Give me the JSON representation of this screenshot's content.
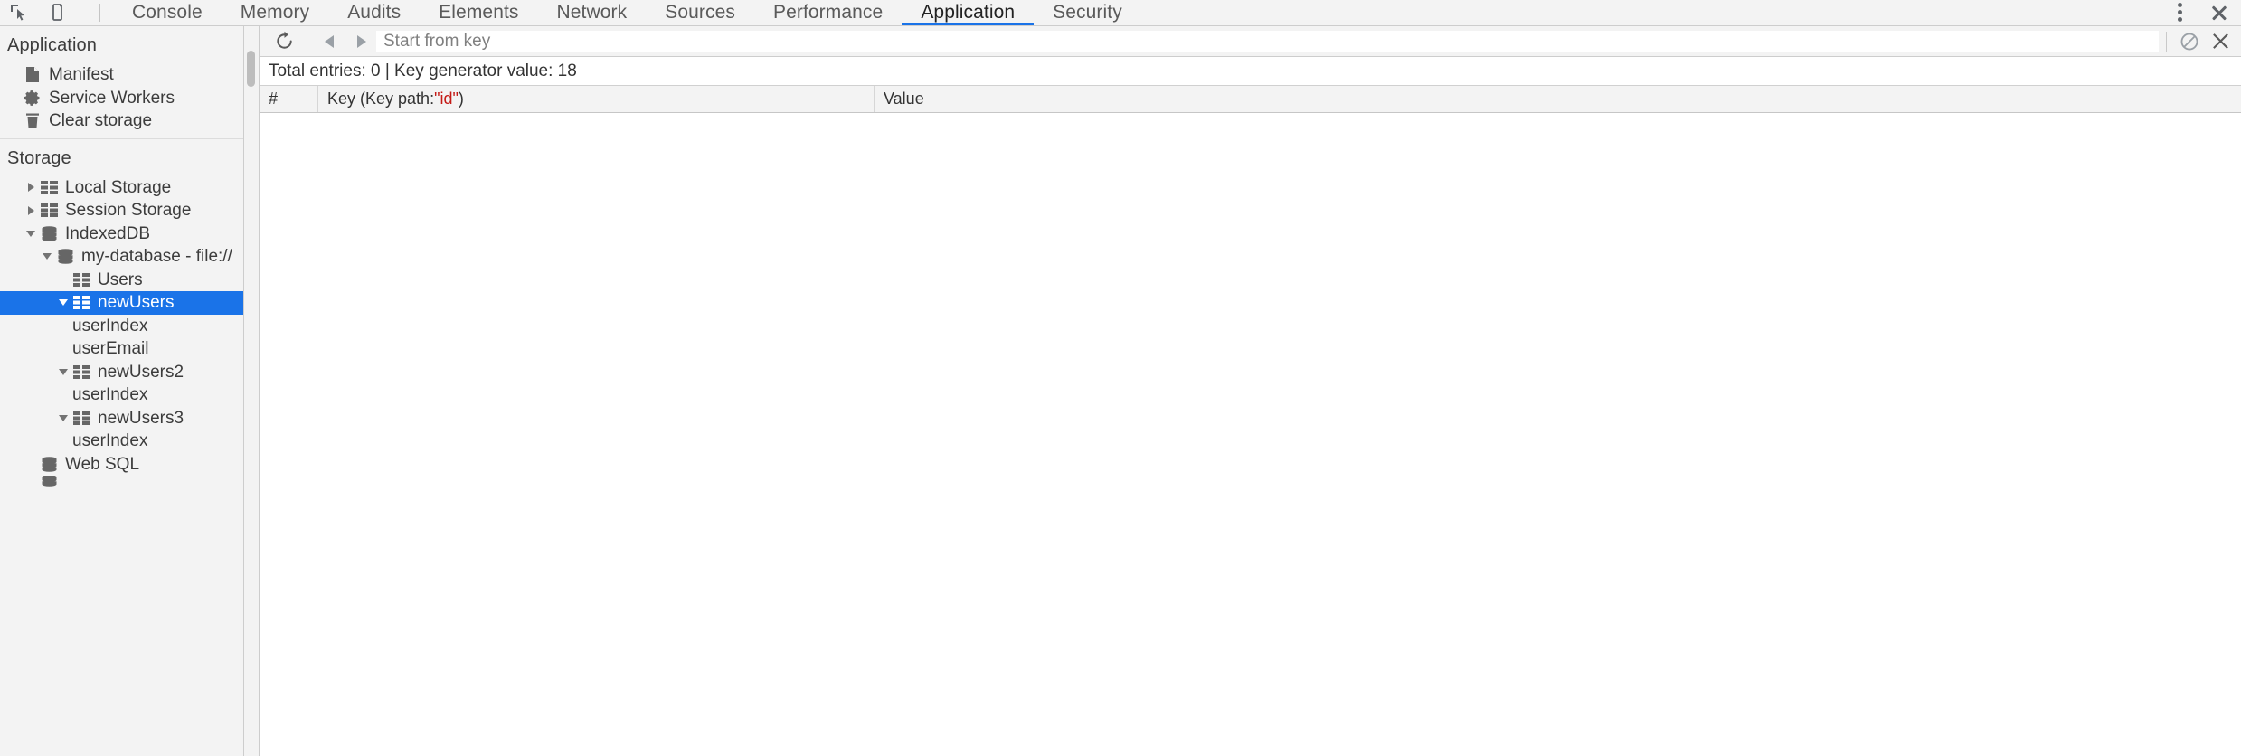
{
  "tabbar": {
    "left_icons": [
      {
        "name": "inspect-element-icon",
        "glyph": "inspect"
      },
      {
        "name": "device-toolbar-icon",
        "glyph": "device"
      }
    ],
    "tabs": [
      {
        "label": "Console",
        "active": false
      },
      {
        "label": "Memory",
        "active": false
      },
      {
        "label": "Audits",
        "active": false
      },
      {
        "label": "Elements",
        "active": false
      },
      {
        "label": "Network",
        "active": false
      },
      {
        "label": "Sources",
        "active": false
      },
      {
        "label": "Performance",
        "active": false
      },
      {
        "label": "Application",
        "active": true
      },
      {
        "label": "Security",
        "active": false
      }
    ],
    "active_tab": "Application",
    "more_options_label": "More options",
    "close_label": "Close DevTools",
    "accent_color": "#1a73e8"
  },
  "sidebar": {
    "application_section": {
      "title": "Application",
      "items": [
        {
          "label": "Manifest",
          "icon": "manifest-document-icon"
        },
        {
          "label": "Service Workers",
          "icon": "gear-icon"
        },
        {
          "label": "Clear storage",
          "icon": "trash-icon"
        }
      ]
    },
    "storage_section": {
      "title": "Storage",
      "items": [
        {
          "label": "Local Storage",
          "icon": "table-icon",
          "expanded": false,
          "indent": 1,
          "has_twisty": true,
          "selected": false
        },
        {
          "label": "Session Storage",
          "icon": "table-icon",
          "expanded": false,
          "indent": 1,
          "has_twisty": true,
          "selected": false
        },
        {
          "label": "IndexedDB",
          "icon": "database-icon",
          "expanded": true,
          "indent": 1,
          "has_twisty": true,
          "selected": false
        },
        {
          "label": "my-database - file://",
          "icon": "database-icon",
          "expanded": true,
          "indent": 2,
          "has_twisty": true,
          "selected": false
        },
        {
          "label": "Users",
          "icon": "table-icon",
          "expanded": false,
          "indent": 3,
          "has_twisty": false,
          "selected": false
        },
        {
          "label": "newUsers",
          "icon": "table-icon",
          "expanded": true,
          "indent": 3,
          "has_twisty": true,
          "selected": true
        },
        {
          "label": "userIndex",
          "icon": "none",
          "expanded": false,
          "indent": 4,
          "has_twisty": false,
          "selected": false
        },
        {
          "label": "userEmail",
          "icon": "none",
          "expanded": false,
          "indent": 4,
          "has_twisty": false,
          "selected": false
        },
        {
          "label": "newUsers2",
          "icon": "table-icon",
          "expanded": true,
          "indent": 3,
          "has_twisty": true,
          "selected": false
        },
        {
          "label": "userIndex",
          "icon": "none",
          "expanded": false,
          "indent": 4,
          "has_twisty": false,
          "selected": false
        },
        {
          "label": "newUsers3",
          "icon": "table-icon",
          "expanded": true,
          "indent": 3,
          "has_twisty": true,
          "selected": false
        },
        {
          "label": "userIndex",
          "icon": "none",
          "expanded": false,
          "indent": 4,
          "has_twisty": false,
          "selected": false
        },
        {
          "label": "Web SQL",
          "icon": "database-icon",
          "expanded": false,
          "indent": 1,
          "has_twisty": false,
          "selected": false
        }
      ]
    },
    "selection_color": "#1a73e8"
  },
  "main": {
    "toolbar": {
      "refresh_label": "Refresh",
      "prev_label": "Show previous page",
      "next_label": "Show next page",
      "clear_label": "Clear object store",
      "delete_label": "Delete selected",
      "key_input_placeholder": "Start from key",
      "key_input_value": ""
    },
    "summary": {
      "text": "Total entries: 0 | Key generator value: 18",
      "total_entries": 0,
      "key_generator_value": 18
    },
    "grid": {
      "columns": [
        {
          "label": "#"
        },
        {
          "label_prefix": "Key (Key path: ",
          "key_path": "\"id\"",
          "label_suffix": ")"
        },
        {
          "label": "Value"
        }
      ],
      "rows": []
    }
  }
}
